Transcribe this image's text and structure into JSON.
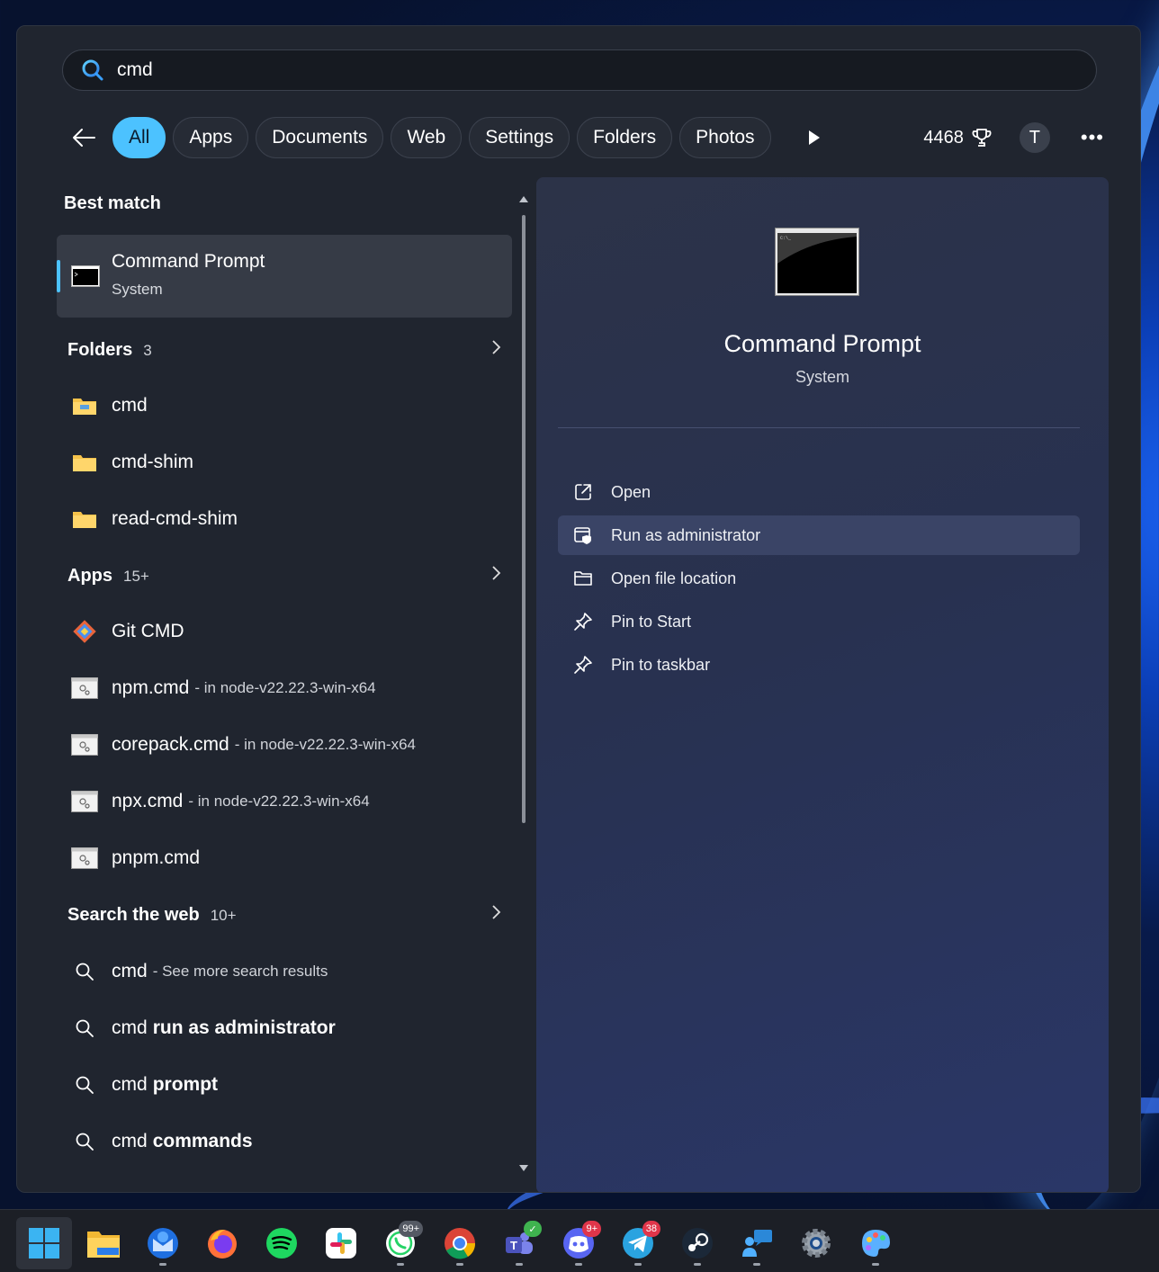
{
  "search": {
    "value": "cmd"
  },
  "filters": {
    "tabs": [
      "All",
      "Apps",
      "Documents",
      "Web",
      "Settings",
      "Folders",
      "Photos"
    ],
    "active": "All",
    "points": "4468",
    "avatar_initial": "T"
  },
  "best_match": {
    "title": "Best match",
    "name": "Command Prompt",
    "type": "System"
  },
  "folders": {
    "title": "Folders",
    "count": "3",
    "items": [
      "cmd",
      "cmd-shim",
      "read-cmd-shim"
    ]
  },
  "apps": {
    "title": "Apps",
    "count": "15+",
    "items": [
      {
        "name": "Git CMD",
        "sub": ""
      },
      {
        "name": "npm.cmd",
        "sub": "- in node-v22.22.3-win-x64"
      },
      {
        "name": "corepack.cmd",
        "sub": "- in node-v22.22.3-win-x64"
      },
      {
        "name": "npx.cmd",
        "sub": "- in node-v22.22.3-win-x64"
      },
      {
        "name": "pnpm.cmd",
        "sub": ""
      }
    ]
  },
  "web": {
    "title": "Search the web",
    "count": "10+",
    "items": [
      {
        "prefix": "cmd",
        "bold": "",
        "sub": "- See more search results"
      },
      {
        "prefix": "cmd",
        "bold": "run as administrator",
        "sub": ""
      },
      {
        "prefix": "cmd",
        "bold": "prompt",
        "sub": ""
      },
      {
        "prefix": "cmd",
        "bold": "commands",
        "sub": ""
      }
    ]
  },
  "preview": {
    "title": "Command Prompt",
    "subtitle": "System",
    "actions": [
      "Open",
      "Run as administrator",
      "Open file location",
      "Pin to Start",
      "Pin to taskbar"
    ]
  },
  "taskbar": {
    "items": [
      "start",
      "file-explorer",
      "thunderbird",
      "firefox",
      "spotify",
      "slack",
      "whatsapp",
      "chrome",
      "teams",
      "discord",
      "telegram",
      "steam",
      "quick-assist",
      "settings",
      "paint"
    ],
    "badges": {
      "whatsapp": "99+",
      "discord": "9+",
      "telegram": "38"
    }
  },
  "colors": {
    "accent": "#4cc2ff",
    "panel": "#20252f",
    "preview": "#2a3150"
  }
}
